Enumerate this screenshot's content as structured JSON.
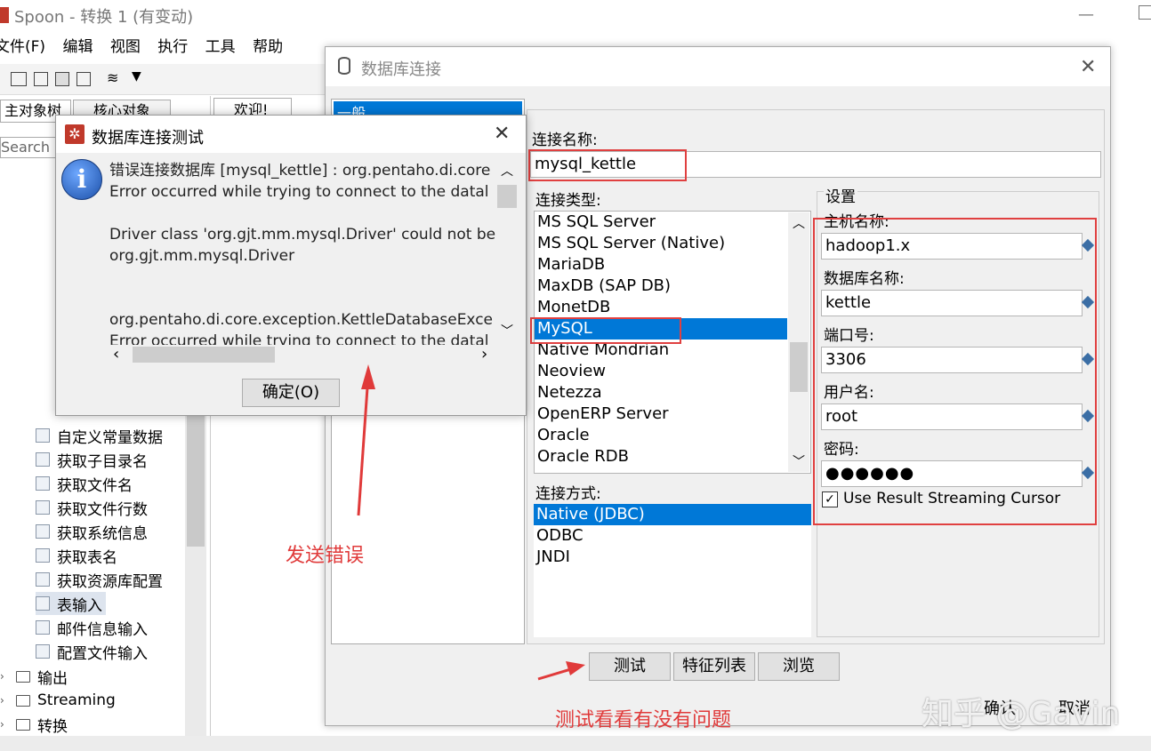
{
  "window": {
    "title": "Spoon - 转换 1 (有变动)"
  },
  "menu": [
    "文件(F)",
    "编辑",
    "视图",
    "执行",
    "工具",
    "帮助"
  ],
  "left_tabs": {
    "main_tree": "主对象树",
    "core_objects": "核心对象"
  },
  "canvas_tab": "欢迎!",
  "search_placeholder": "Search",
  "tree_items": [
    "自定义常量数据",
    "获取子目录名",
    "获取文件名",
    "获取文件行数",
    "获取系统信息",
    "获取表名",
    "获取资源库配置",
    "表输入",
    "邮件信息输入",
    "配置文件输入"
  ],
  "tree_folders": [
    "输出",
    "Streaming",
    "转换"
  ],
  "db_dialog": {
    "title": "数据库连接",
    "left_tab": "一般",
    "conn_name_label": "连接名称:",
    "conn_name_value": "mysql_kettle",
    "conn_type_label": "连接类型:",
    "conn_types": [
      "MS SQL Server",
      "MS SQL Server (Native)",
      "MariaDB",
      "MaxDB (SAP DB)",
      "MonetDB",
      "MySQL",
      "Native Mondrian",
      "Neoview",
      "Netezza",
      "OpenERP Server",
      "Oracle",
      "Oracle RDB"
    ],
    "conn_type_selected": "MySQL",
    "access_label": "连接方式:",
    "access_methods": [
      "Native (JDBC)",
      "ODBC",
      "JNDI"
    ],
    "access_selected": "Native (JDBC)",
    "settings_label": "设置",
    "host_label": "主机名称:",
    "host_value": "hadoop1.x",
    "dbname_label": "数据库名称:",
    "dbname_value": "kettle",
    "port_label": "端口号:",
    "port_value": "3306",
    "user_label": "用户名:",
    "user_value": "root",
    "password_label": "密码:",
    "password_value": "●●●●●●",
    "streaming_label": "Use Result Streaming Cursor",
    "streaming_checked": true,
    "btn_test": "测试",
    "btn_features": "特征列表",
    "btn_explore": "浏览",
    "btn_ok": "确认",
    "btn_cancel": "取消"
  },
  "test_dialog": {
    "title": "数据库连接测试",
    "message": "错误连接数据库 [mysql_kettle] : org.pentaho.di.core\nError occurred while trying to connect to the datal\n\nDriver class 'org.gjt.mm.mysql.Driver' could not be\norg.gjt.mm.mysql.Driver\n\n\norg.pentaho.di.core.exception.KettleDatabaseExce\nError occurred while trying to connect to the datal",
    "ok_button": "确定(O)"
  },
  "annotations": {
    "error_note": "发送错误",
    "test_note": "测试看看有没有问题",
    "watermark": "知乎 @Gavin"
  },
  "colors": {
    "selection": "#0078d7",
    "annotation": "#e03a3a"
  }
}
